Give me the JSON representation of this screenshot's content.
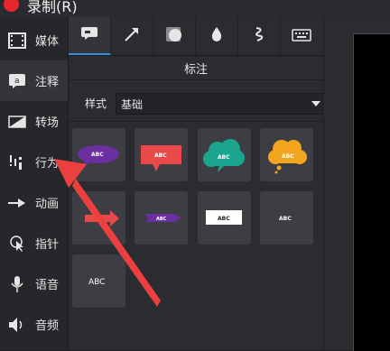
{
  "window": {
    "title": "录制(R)"
  },
  "sidebar": {
    "items": [
      {
        "label": "媒体",
        "icon": "film-icon"
      },
      {
        "label": "注释",
        "icon": "annotation-icon",
        "active": true
      },
      {
        "label": "转场",
        "icon": "transition-icon"
      },
      {
        "label": "行为",
        "icon": "behavior-icon"
      },
      {
        "label": "动画",
        "icon": "animation-icon"
      },
      {
        "label": "指针",
        "icon": "cursor-icon"
      },
      {
        "label": "语音",
        "icon": "microphone-icon"
      },
      {
        "label": "音频",
        "icon": "speaker-icon"
      }
    ]
  },
  "toolbar": {
    "tabs": [
      {
        "icon": "callout-icon",
        "active": true
      },
      {
        "icon": "arrow-icon"
      },
      {
        "icon": "shape-icon"
      },
      {
        "icon": "blur-icon"
      },
      {
        "icon": "sketch-motion-icon"
      },
      {
        "icon": "keystroke-icon"
      }
    ]
  },
  "panel": {
    "title": "标注",
    "style_label": "样式",
    "style_value": "基础"
  },
  "callouts": {
    "text": "ABC",
    "colors": {
      "purple": "#6b2fa0",
      "red": "#e84a4a",
      "teal": "#1aa58e",
      "orange": "#f2a51f",
      "tile": "#3d3e43"
    }
  },
  "annotation_arrow": {
    "color": "#ec4040"
  }
}
